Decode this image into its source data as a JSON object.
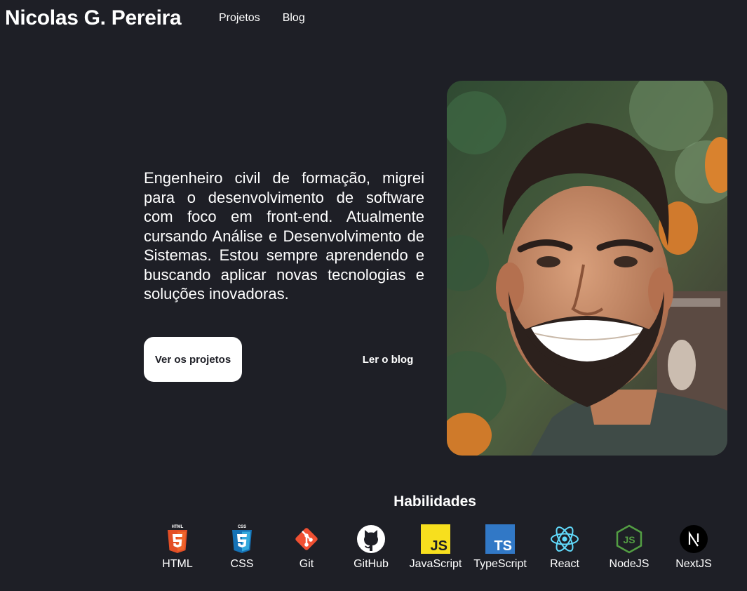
{
  "header": {
    "title": "Nicolas G. Pereira",
    "nav": [
      {
        "label": "Projetos"
      },
      {
        "label": "Blog"
      }
    ]
  },
  "hero": {
    "intro": "Engenheiro civil de formação, migrei para o desenvolvimento de software com foco em front-end. Atualmente cursando Análise e Desenvolvimento de Sistemas. Estou sempre aprendendo e buscando aplicar novas tecnologias e soluções inovadoras.",
    "primary_button": "Ver os projetos",
    "secondary_button": "Ler o blog"
  },
  "skills": {
    "title": "Habilidades",
    "items": [
      {
        "label": "HTML",
        "icon": "html5-icon",
        "color": "#e34f26"
      },
      {
        "label": "CSS",
        "icon": "css3-icon",
        "color": "#1572b6"
      },
      {
        "label": "Git",
        "icon": "git-icon",
        "color": "#f05032"
      },
      {
        "label": "GitHub",
        "icon": "github-icon",
        "color": "#ffffff"
      },
      {
        "label": "JavaScript",
        "icon": "javascript-icon",
        "color": "#f7df1e"
      },
      {
        "label": "TypeScript",
        "icon": "typescript-icon",
        "color": "#3178c6"
      },
      {
        "label": "React",
        "icon": "react-icon",
        "color": "#61dafb"
      },
      {
        "label": "NodeJS",
        "icon": "nodejs-icon",
        "color": "#539e43"
      },
      {
        "label": "NextJS",
        "icon": "nextjs-icon",
        "color": "#000000"
      }
    ]
  },
  "colors": {
    "background": "#1e1f26",
    "text": "#ffffff",
    "button_bg": "#ffffff"
  }
}
